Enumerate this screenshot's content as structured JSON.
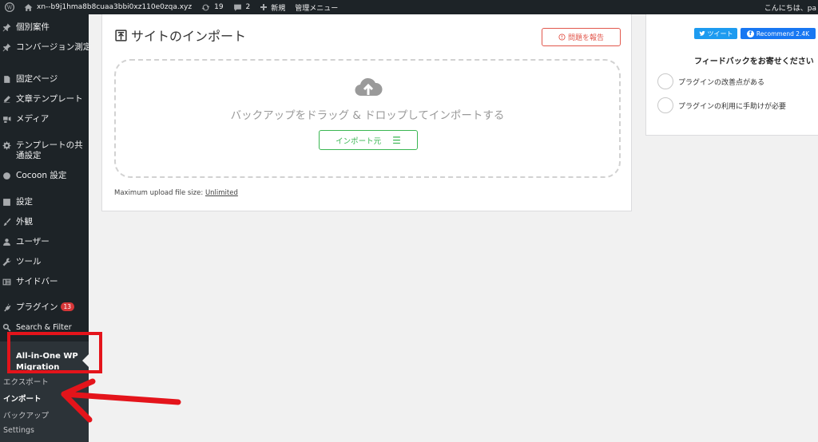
{
  "adminbar": {
    "site_name": "xn--b9j1hma8b8cuaa3bbi0xz110e0zqa.xyz",
    "updates_count": "19",
    "comments_count": "2",
    "new_label": "新規",
    "admin_menu_label": "管理メニュー",
    "greeting": "こんにちは、pa"
  },
  "sidebar": {
    "items": [
      {
        "label": "個別案件",
        "icon": "pin-icon"
      },
      {
        "label": "コンバージョン測定",
        "icon": "pin-icon"
      },
      {
        "label": "固定ページ",
        "icon": "page-icon"
      },
      {
        "label": "文章テンプレート",
        "icon": "pencil-icon"
      },
      {
        "label": "メディア",
        "icon": "media-icon"
      },
      {
        "label": "テンプレートの共通設定",
        "icon": "gear-icon"
      },
      {
        "label": "Cocoon 設定",
        "icon": "circle-icon"
      },
      {
        "label": "設定",
        "icon": "settings-icon"
      },
      {
        "label": "外観",
        "icon": "brush-icon"
      },
      {
        "label": "ユーザー",
        "icon": "user-icon"
      },
      {
        "label": "ツール",
        "icon": "wrench-icon"
      },
      {
        "label": "サイドバー",
        "icon": "sidebar-icon"
      },
      {
        "label": "プラグイン",
        "icon": "plugin-icon",
        "badge": "13"
      },
      {
        "label": "Search & Filter",
        "icon": "search-icon"
      }
    ],
    "current_item": "All-in-One WP Migration",
    "submenu": [
      "エクスポート",
      "インポート",
      "バックアップ",
      "Settings"
    ],
    "active_submenu_index": 1
  },
  "main": {
    "title": "サイトのインポート",
    "report_button": "問題を報告",
    "drop_text": "バックアップをドラッグ & ドロップしてインポートする",
    "import_button": "インポート元",
    "max_upload_label": "Maximum upload file size:",
    "max_upload_value": "Unlimited"
  },
  "side_panel": {
    "tweet_button": "ツイート",
    "recommend_button": "Recommend 2.4K",
    "feedback_title": "フィードバックをお寄せください",
    "options": [
      "プラグインの改善点がある",
      "プラグインの利用に手助けが必要"
    ]
  },
  "colors": {
    "admin_dark": "#1d2327",
    "accent_red": "#e2574c",
    "accent_green": "#3ab652",
    "annotation_red": "#e4141b",
    "twitter_blue": "#1d9bf0",
    "facebook_blue": "#1877f2"
  }
}
